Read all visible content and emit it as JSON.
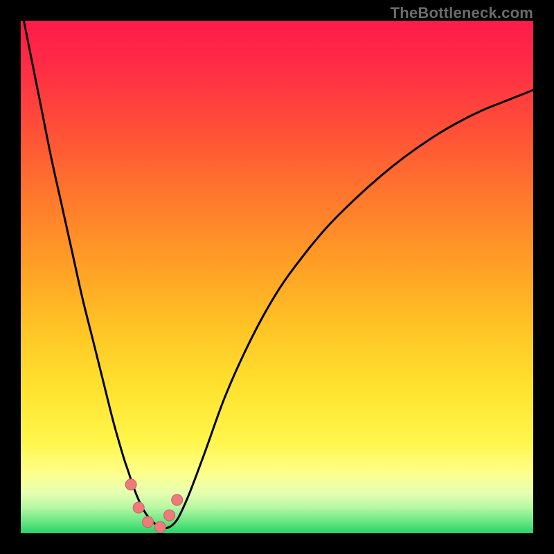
{
  "watermark": "TheBottleneck.com",
  "colors": {
    "black": "#000000",
    "curve": "#000000",
    "marker_fill": "#ee7b7b",
    "marker_stroke": "#c46060"
  },
  "gradient_stops": [
    {
      "offset": 0.0,
      "color": "#ff1a4b"
    },
    {
      "offset": 0.1,
      "color": "#ff2f44"
    },
    {
      "offset": 0.22,
      "color": "#ff5236"
    },
    {
      "offset": 0.35,
      "color": "#ff7a2c"
    },
    {
      "offset": 0.48,
      "color": "#ffa025"
    },
    {
      "offset": 0.6,
      "color": "#ffc425"
    },
    {
      "offset": 0.72,
      "color": "#ffe330"
    },
    {
      "offset": 0.82,
      "color": "#fff64a"
    },
    {
      "offset": 0.88,
      "color": "#ffff88"
    },
    {
      "offset": 0.92,
      "color": "#e7ffb0"
    },
    {
      "offset": 0.95,
      "color": "#b6f7a3"
    },
    {
      "offset": 0.975,
      "color": "#6fe885"
    },
    {
      "offset": 1.0,
      "color": "#27d36a"
    }
  ],
  "chart_data": {
    "type": "line",
    "title": "",
    "xlabel": "",
    "ylabel": "",
    "xlim": [
      0,
      100
    ],
    "ylim": [
      0,
      100
    ],
    "series": [
      {
        "name": "bottleneck-curve",
        "x": [
          0,
          2,
          4,
          6,
          8,
          10,
          12,
          14,
          16,
          18,
          20,
          21,
          22,
          23,
          24,
          25,
          26,
          27,
          28,
          29,
          30,
          31,
          33,
          36,
          40,
          45,
          50,
          55,
          60,
          65,
          70,
          75,
          80,
          85,
          90,
          95,
          100
        ],
        "y": [
          103,
          93,
          83,
          73,
          64,
          55,
          46,
          38,
          30,
          22,
          15,
          12,
          9,
          6.5,
          4.5,
          3,
          2,
          1.3,
          1,
          1.2,
          2,
          3.5,
          8,
          16,
          27,
          38,
          47,
          54,
          60,
          65,
          69.5,
          73.5,
          77,
          80,
          82.5,
          84.5,
          86.5
        ]
      }
    ],
    "markers": {
      "name": "highlight-points",
      "x": [
        21.5,
        23,
        24.8,
        27.2,
        29,
        30.5
      ],
      "y": [
        9.5,
        5,
        2.2,
        1.2,
        3.5,
        6.5
      ]
    }
  }
}
